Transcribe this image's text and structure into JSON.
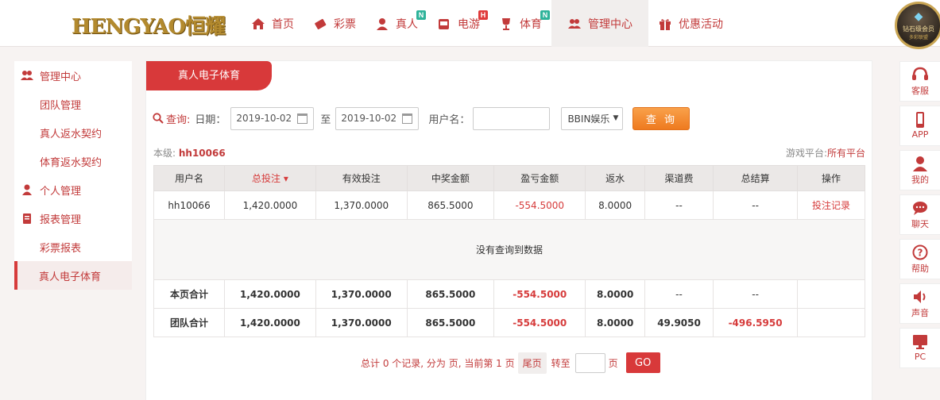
{
  "logo": {
    "text": "HENGYAO恒耀"
  },
  "nav": [
    {
      "label": "首页",
      "icon": "home-icon",
      "badge": ""
    },
    {
      "label": "彩票",
      "icon": "lottery-icon",
      "badge": ""
    },
    {
      "label": "真人",
      "icon": "live-icon",
      "badge": "N"
    },
    {
      "label": "电游",
      "icon": "slot-icon",
      "badge": "H"
    },
    {
      "label": "体育",
      "icon": "trophy-icon",
      "badge": "N"
    },
    {
      "label": "管理中心",
      "icon": "users-icon",
      "badge": ""
    },
    {
      "label": "优惠活动",
      "icon": "gift-icon",
      "badge": ""
    }
  ],
  "vip": {
    "line1": "钻石级会员",
    "line2": "多彩联盟"
  },
  "sidebar": [
    {
      "label": "管理中心",
      "head": true
    },
    {
      "label": "团队管理"
    },
    {
      "label": "真人返水契约"
    },
    {
      "label": "体育返水契约"
    },
    {
      "label": "个人管理",
      "head": true
    },
    {
      "label": "报表管理",
      "head": true
    },
    {
      "label": "彩票报表"
    },
    {
      "label": "真人电子体育",
      "active": true
    }
  ],
  "tab": {
    "label": "真人电子体育"
  },
  "query": {
    "label": "查询:",
    "date_label": "日期：",
    "date_from": "2019-10-02",
    "to": "至",
    "date_to": "2019-10-02",
    "username_label": "用户名：",
    "username_value": "",
    "platform_select": "BBIN娱乐",
    "button": "查 询"
  },
  "info": {
    "level_label": "本级:",
    "level_user": "hh10066",
    "platform_label": "游戏平台:",
    "platform_value": "所有平台"
  },
  "table": {
    "headers": [
      "用户名",
      "总投注",
      "有效投注",
      "中奖金额",
      "盈亏金额",
      "返水",
      "渠道费",
      "总结算",
      "操作"
    ],
    "row": [
      "hh10066",
      "1,420.0000",
      "1,370.0000",
      "865.5000",
      "-554.5000",
      "8.0000",
      "--",
      "--",
      "投注记录"
    ],
    "empty_text": "没有查询到数据",
    "page_total": [
      "本页合计",
      "1,420.0000",
      "1,370.0000",
      "865.5000",
      "-554.5000",
      "8.0000",
      "--",
      "--",
      ""
    ],
    "team_total": [
      "团队合计",
      "1,420.0000",
      "1,370.0000",
      "865.5000",
      "-554.5000",
      "8.0000",
      "49.9050",
      "-496.5950",
      ""
    ]
  },
  "pager": {
    "summary": "总计 0 个记录, 分为 页, 当前第 1 页",
    "last": "尾页",
    "goto": "转至",
    "page_unit": "页",
    "go": "GO"
  },
  "rightbar": [
    {
      "label": "客服",
      "icon": "headset-icon"
    },
    {
      "label": "APP",
      "icon": "phone-icon"
    },
    {
      "label": "我的",
      "icon": "user-icon"
    },
    {
      "label": "聊天",
      "icon": "chat-icon"
    },
    {
      "label": "帮助",
      "icon": "help-icon"
    },
    {
      "label": "声音",
      "icon": "speaker-icon"
    },
    {
      "label": "PC",
      "icon": "monitor-icon"
    }
  ],
  "colors": {
    "accent": "#d8393a",
    "text_red": "#c23a3a",
    "orange": "#ee7a1f"
  }
}
